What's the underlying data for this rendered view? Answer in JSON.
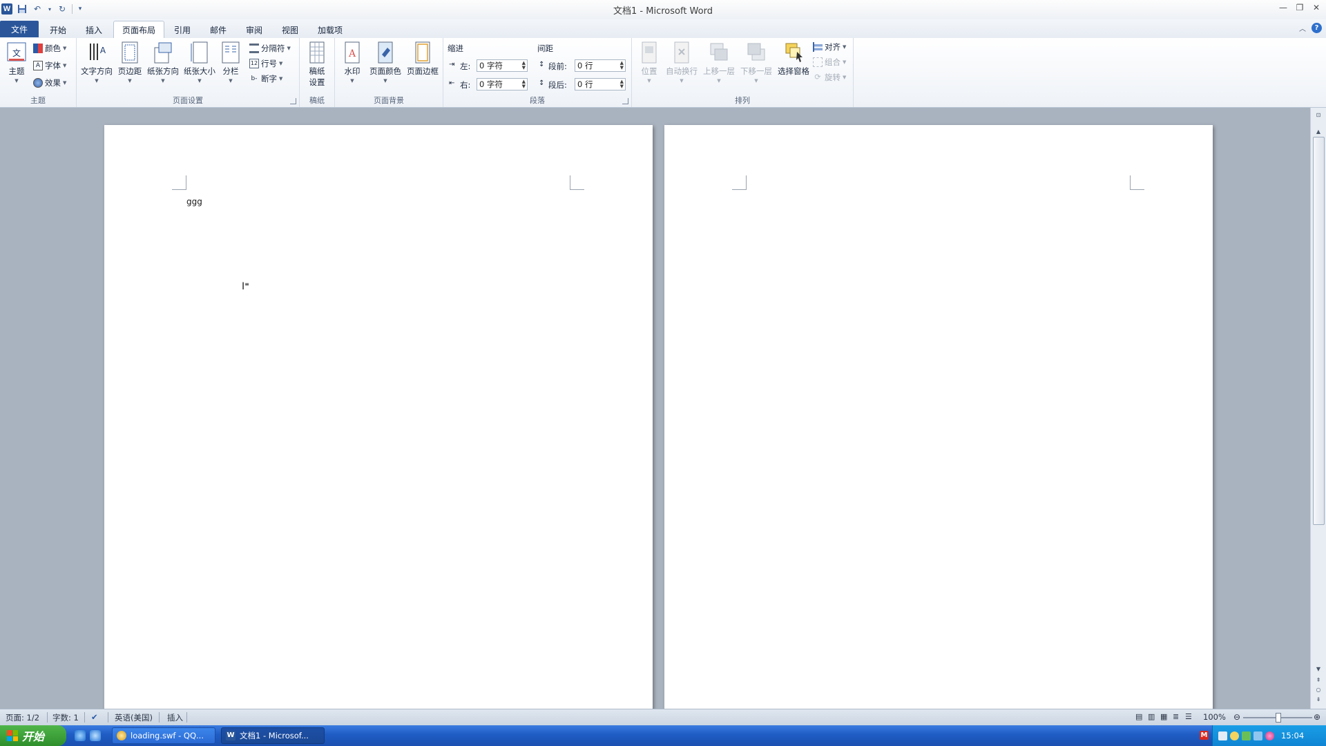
{
  "window": {
    "title": "文档1 - Microsoft Word",
    "app_logo": "W"
  },
  "tabs": [
    "文件",
    "开始",
    "插入",
    "页面布局",
    "引用",
    "邮件",
    "审阅",
    "视图",
    "加载项"
  ],
  "active_tab": "页面布局",
  "ribbon": {
    "theme_group": {
      "label": "主题",
      "themes_button": "主题",
      "colors": "颜色",
      "fonts": "字体",
      "effects": "效果"
    },
    "page_setup_group": {
      "label": "页面设置",
      "text_direction": "文字方向",
      "margins": "页边距",
      "orientation": "纸张方向",
      "size": "纸张大小",
      "columns": "分栏",
      "breaks": "分隔符",
      "line_numbers": "行号",
      "hyphenation": "断字"
    },
    "manuscript_group": {
      "label": "稿纸",
      "settings_line1": "稿纸",
      "settings_line2": "设置"
    },
    "page_background_group": {
      "label": "页面背景",
      "watermark": "水印",
      "page_color": "页面颜色",
      "page_borders": "页面边框"
    },
    "paragraph_group": {
      "label": "段落",
      "indent_header": "缩进",
      "spacing_header": "间距",
      "left_label": "左:",
      "left_value": "0 字符",
      "right_label": "右:",
      "right_value": "0 字符",
      "before_label": "段前:",
      "before_value": "0 行",
      "after_label": "段后:",
      "after_value": "0 行"
    },
    "arrange_group": {
      "label": "排列",
      "position": "位置",
      "wrap_text": "自动换行",
      "bring_forward": "上移一层",
      "send_backward": "下移一层",
      "selection_pane": "选择窗格",
      "align": "对齐",
      "group": "组合",
      "rotate": "旋转"
    }
  },
  "document": {
    "page1_text": "ggg"
  },
  "statusbar": {
    "page": "页面: 1/2",
    "words": "字数: 1",
    "language": "英语(美国)",
    "mode": "插入",
    "zoom": "100%"
  },
  "taskbar": {
    "start_label": "开始",
    "task1": "loading.swf - QQ...",
    "task2": "文档1 - Microsof...",
    "clock": "15:04"
  },
  "colors": {
    "file_tab": "#2b579a",
    "doc_background": "#a9b3bf",
    "taskbar": "#1f5cc4",
    "start_button": "#2e8f2b"
  }
}
